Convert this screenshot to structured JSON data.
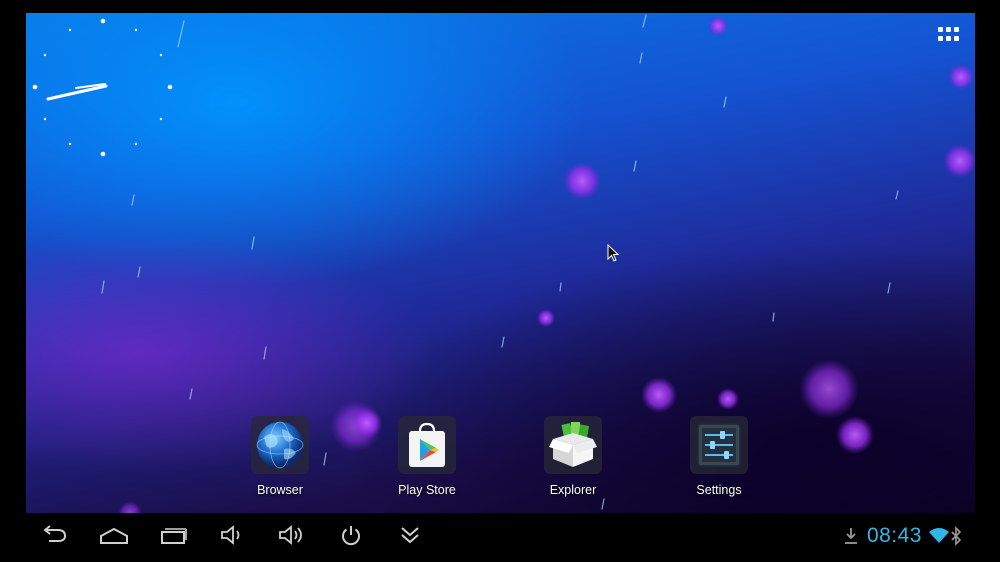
{
  "wallpaper": {
    "name": "phase-beam-wallpaper"
  },
  "clock_widget": {
    "type": "analog",
    "face_dots": 12
  },
  "app_drawer": {
    "icon": "grid-apps-icon"
  },
  "dock": {
    "apps": [
      {
        "label": "Browser",
        "icon": "globe-icon"
      },
      {
        "label": "Play Store",
        "icon": "play-store-icon"
      },
      {
        "label": "Explorer",
        "icon": "explorer-box-icon"
      },
      {
        "label": "Settings",
        "icon": "settings-sliders-icon"
      }
    ]
  },
  "navbar": {
    "buttons": [
      "back-icon",
      "home-icon",
      "recent-apps-icon",
      "volume-down-icon",
      "volume-up-icon",
      "power-icon",
      "expand-down-icon"
    ]
  },
  "status": {
    "time": "08:43",
    "download_icon": "download-icon",
    "wifi_icon": "wifi-icon",
    "bluetooth_icon": "bluetooth-icon",
    "accent_color": "#33b5e5"
  }
}
